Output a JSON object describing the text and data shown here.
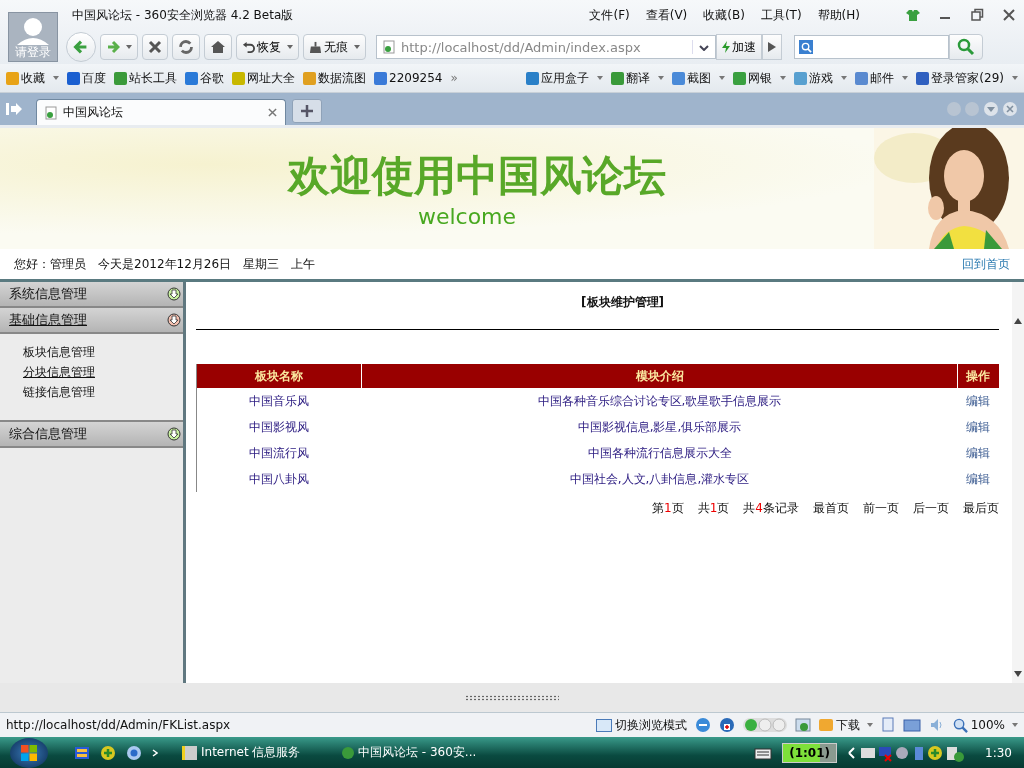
{
  "window": {
    "title": "中国风论坛 - 360安全浏览器 4.2 Beta版",
    "login_label": "请登录"
  },
  "menu": [
    "文件(F)",
    "查看(V)",
    "收藏(B)",
    "工具(T)",
    "帮助(H)"
  ],
  "toolbar": {
    "restore": "恢复",
    "incognito": "无痕",
    "address": "http://localhost/dd/Admin/index.aspx",
    "accelerate": "加速"
  },
  "bookmarks": [
    {
      "label": "收藏",
      "dropdown": true
    },
    {
      "label": "百度",
      "dropdown": false
    },
    {
      "label": "站长工具",
      "dropdown": false
    },
    {
      "label": "谷歌",
      "dropdown": false
    },
    {
      "label": "网址大全",
      "dropdown": false
    },
    {
      "label": "数据流图",
      "dropdown": false
    },
    {
      "label": "2209254",
      "dropdown": false
    }
  ],
  "bookmarks_more": "»",
  "apps": [
    {
      "label": "应用盒子",
      "dropdown": true
    },
    {
      "label": "翻译",
      "dropdown": true
    },
    {
      "label": "截图",
      "dropdown": true
    },
    {
      "label": "网银",
      "dropdown": true
    },
    {
      "label": "游戏",
      "dropdown": true
    },
    {
      "label": "邮件",
      "dropdown": true
    },
    {
      "label": "登录管家(29)",
      "dropdown": true
    }
  ],
  "tabs": [
    {
      "label": "中国风论坛",
      "selected": true
    }
  ],
  "banner": {
    "title": "欢迎使用中国风论坛",
    "subtitle": "welcome"
  },
  "greeting": {
    "user": "您好：管理员",
    "date": "今天是2012年12月26日",
    "weekday": "星期三",
    "period": "上午",
    "home_link": "回到首页"
  },
  "sidebar": [
    {
      "label": "系统信息管理",
      "expanded": false
    },
    {
      "label": "基础信息管理",
      "expanded": true,
      "items": [
        {
          "label": "板块信息管理",
          "hovered": false
        },
        {
          "label": "分块信息管理",
          "hovered": true
        },
        {
          "label": "链接信息管理",
          "hovered": false
        }
      ]
    },
    {
      "label": "综合信息管理",
      "expanded": false
    }
  ],
  "content": {
    "title": "[板块维护管理]",
    "table": {
      "columns": [
        "板块名称",
        "模块介绍",
        "操作"
      ],
      "rows": [
        [
          "中国音乐风",
          "中国各种音乐综合讨论专区,歌星歌手信息展示",
          "编辑"
        ],
        [
          "中国影视风",
          "中国影视信息,影星,俱乐部展示",
          "编辑"
        ],
        [
          "中国流行风",
          "中国各种流行信息展示大全",
          "编辑"
        ],
        [
          "中国八卦风",
          "中国社会,人文,八卦信息,灌水专区",
          "编辑"
        ]
      ]
    },
    "pager_stats": [
      {
        "prefix": "第",
        "number": "1",
        "suffix": "页"
      },
      {
        "prefix": "共",
        "number": "1",
        "suffix": "页"
      },
      {
        "prefix": "共",
        "number": "4",
        "suffix": "条记录"
      }
    ],
    "pager_links": [
      "最首页",
      "前一页",
      "后一页",
      "最后页"
    ]
  },
  "status_bar": {
    "url": "http://localhost/dd/Admin/FKList.aspx",
    "mode": "切换浏览模式",
    "download": "下载",
    "zoom": "100%"
  },
  "taskbar": {
    "items": [
      "Internet 信息服务",
      "中国风论坛 - 360安..."
    ],
    "battery": "(1:01)",
    "clock": "1:30"
  }
}
